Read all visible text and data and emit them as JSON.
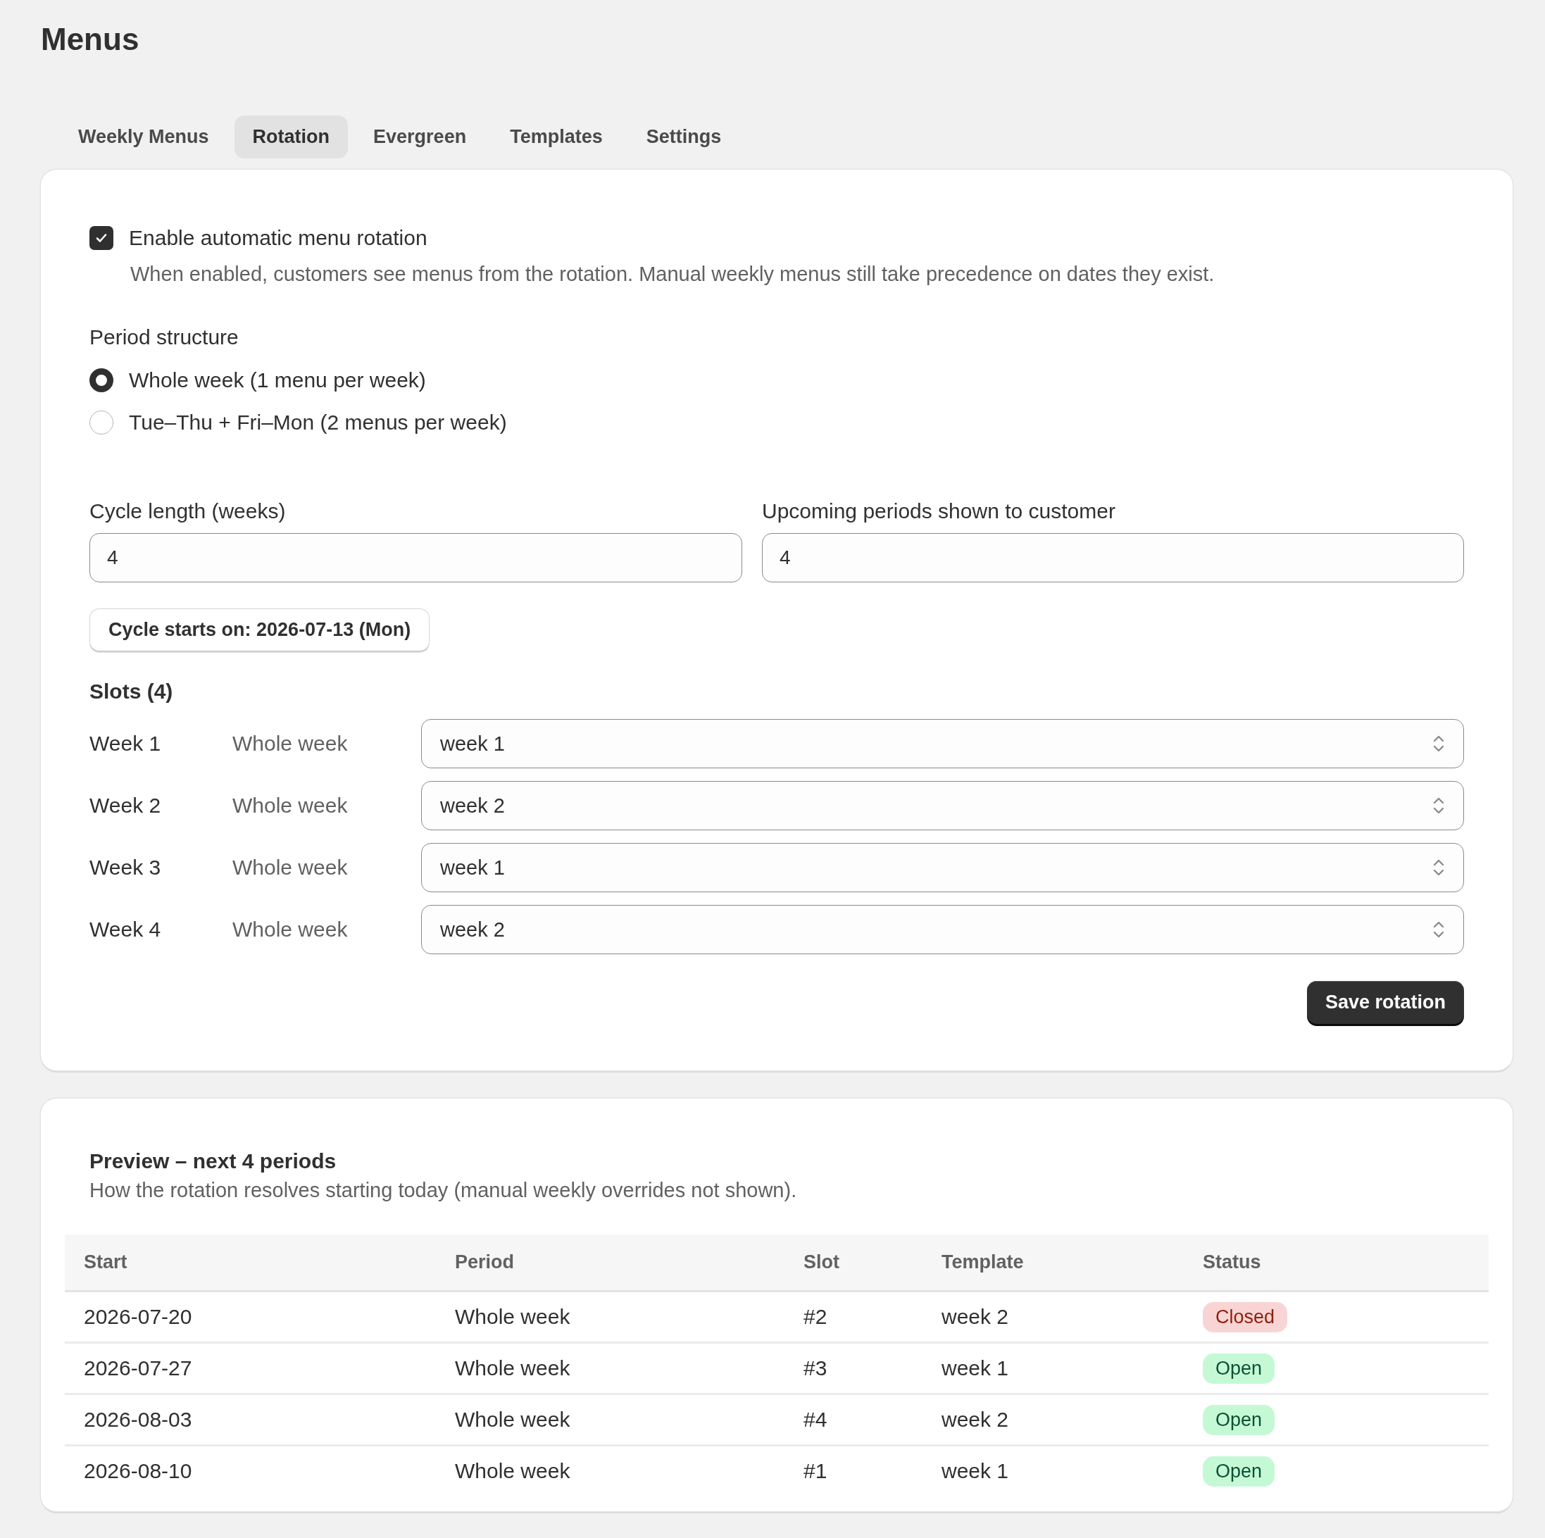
{
  "page": {
    "title": "Menus"
  },
  "tabs": [
    {
      "label": "Weekly Menus",
      "selected": false
    },
    {
      "label": "Rotation",
      "selected": true
    },
    {
      "label": "Evergreen",
      "selected": false
    },
    {
      "label": "Templates",
      "selected": false
    },
    {
      "label": "Settings",
      "selected": false
    }
  ],
  "rotation": {
    "enable": {
      "label": "Enable automatic menu rotation",
      "checked": true,
      "description": "When enabled, customers see menus from the rotation. Manual weekly menus still take precedence on dates they exist."
    },
    "period_structure": {
      "label": "Period structure",
      "options": [
        {
          "label": "Whole week (1 menu per week)",
          "selected": true
        },
        {
          "label": "Tue–Thu + Fri–Mon (2 menus per week)",
          "selected": false
        }
      ]
    },
    "cycle_length": {
      "label": "Cycle length (weeks)",
      "value": "4"
    },
    "upcoming_periods": {
      "label": "Upcoming periods shown to customer",
      "value": "4"
    },
    "cycle_start_button": "Cycle starts on: 2026-07-13 (Mon)",
    "slots": {
      "title": "Slots (4)",
      "rows": [
        {
          "week": "Week 1",
          "period": "Whole week",
          "template": "week 1"
        },
        {
          "week": "Week 2",
          "period": "Whole week",
          "template": "week 2"
        },
        {
          "week": "Week 3",
          "period": "Whole week",
          "template": "week 1"
        },
        {
          "week": "Week 4",
          "period": "Whole week",
          "template": "week 2"
        }
      ]
    },
    "save_button": "Save rotation"
  },
  "preview": {
    "title": "Preview – next 4 periods",
    "subtitle": "How the rotation resolves starting today (manual weekly overrides not shown).",
    "columns": [
      "Start",
      "Period",
      "Slot",
      "Template",
      "Status"
    ],
    "rows": [
      {
        "start": "2026-07-20",
        "period": "Whole week",
        "slot": "#2",
        "template": "week 2",
        "status": {
          "label": "Closed",
          "kind": "closed"
        }
      },
      {
        "start": "2026-07-27",
        "period": "Whole week",
        "slot": "#3",
        "template": "week 1",
        "status": {
          "label": "Open",
          "kind": "open"
        }
      },
      {
        "start": "2026-08-03",
        "period": "Whole week",
        "slot": "#4",
        "template": "week 2",
        "status": {
          "label": "Open",
          "kind": "open"
        }
      },
      {
        "start": "2026-08-10",
        "period": "Whole week",
        "slot": "#1",
        "template": "week 1",
        "status": {
          "label": "Open",
          "kind": "open"
        }
      }
    ]
  }
}
